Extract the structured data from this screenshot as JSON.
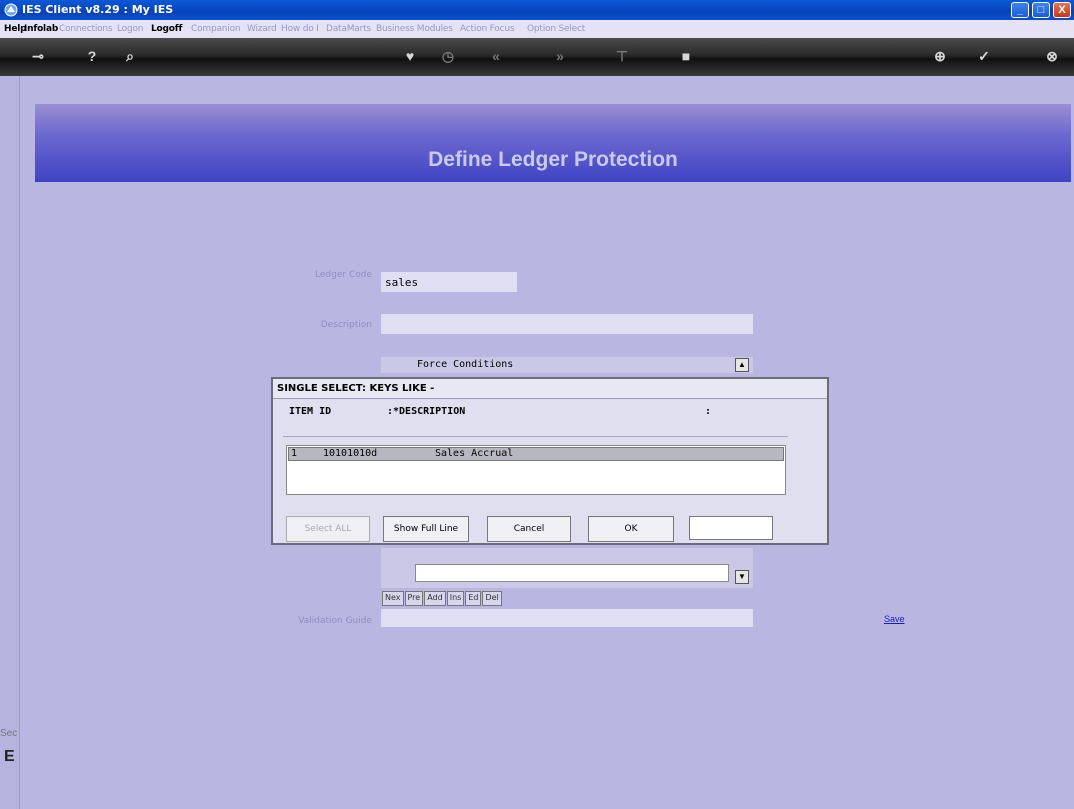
{
  "window": {
    "title": "IES Client v8.29 : My IES",
    "min": "_",
    "max": "□",
    "close": "X"
  },
  "menu": [
    {
      "label": "Help",
      "active": true
    },
    {
      "label": "Infolab",
      "active": true
    },
    {
      "label": "Connections",
      "active": false
    },
    {
      "label": "Logon",
      "active": false
    },
    {
      "label": "Logoff",
      "active": true
    },
    {
      "label": "Companion",
      "active": false
    },
    {
      "label": "Wizard",
      "active": false
    },
    {
      "label": "How do I",
      "active": false
    },
    {
      "label": "DataMarts",
      "active": false
    },
    {
      "label": "Business Modules",
      "active": false
    },
    {
      "label": "Action Focus",
      "active": false
    },
    {
      "label": "Option Select",
      "active": false
    }
  ],
  "toolbar": {
    "key": "⊸",
    "help": "?",
    "search": "⌕",
    "heart": "♥",
    "clock": "◷",
    "prev": "«",
    "next": "»",
    "tool": "⊤",
    "stop": "■",
    "up": "⊕",
    "check": "✓",
    "close": "⊗"
  },
  "banner": {
    "title": "Define Ledger Protection"
  },
  "form": {
    "ledger_code_label": "Ledger Code",
    "ledger_code_value": "sales",
    "description_label": "Description",
    "description_value": "",
    "force_conditions": "Force Conditions",
    "validation_guide_label": "Validation Guide",
    "save_link": "Save",
    "mini_buttons": [
      "Nex",
      "Pre",
      "Add",
      "Ins",
      "Ed",
      "Del"
    ]
  },
  "dialog": {
    "title": "SINGLE SELECT: KEYS LIKE -",
    "col_item_id": "ITEM ID",
    "col_description": ":*DESCRIPTION",
    "col_end": ":",
    "rows": [
      {
        "num": "1",
        "item_id": "10101010d",
        "description": "Sales Accrual"
      }
    ],
    "buttons": {
      "select_all": "Select ALL",
      "show_full_line": "Show Full Line",
      "cancel": "Cancel",
      "ok": "OK"
    }
  },
  "left": {
    "sec": "Sec",
    "big": "E"
  }
}
